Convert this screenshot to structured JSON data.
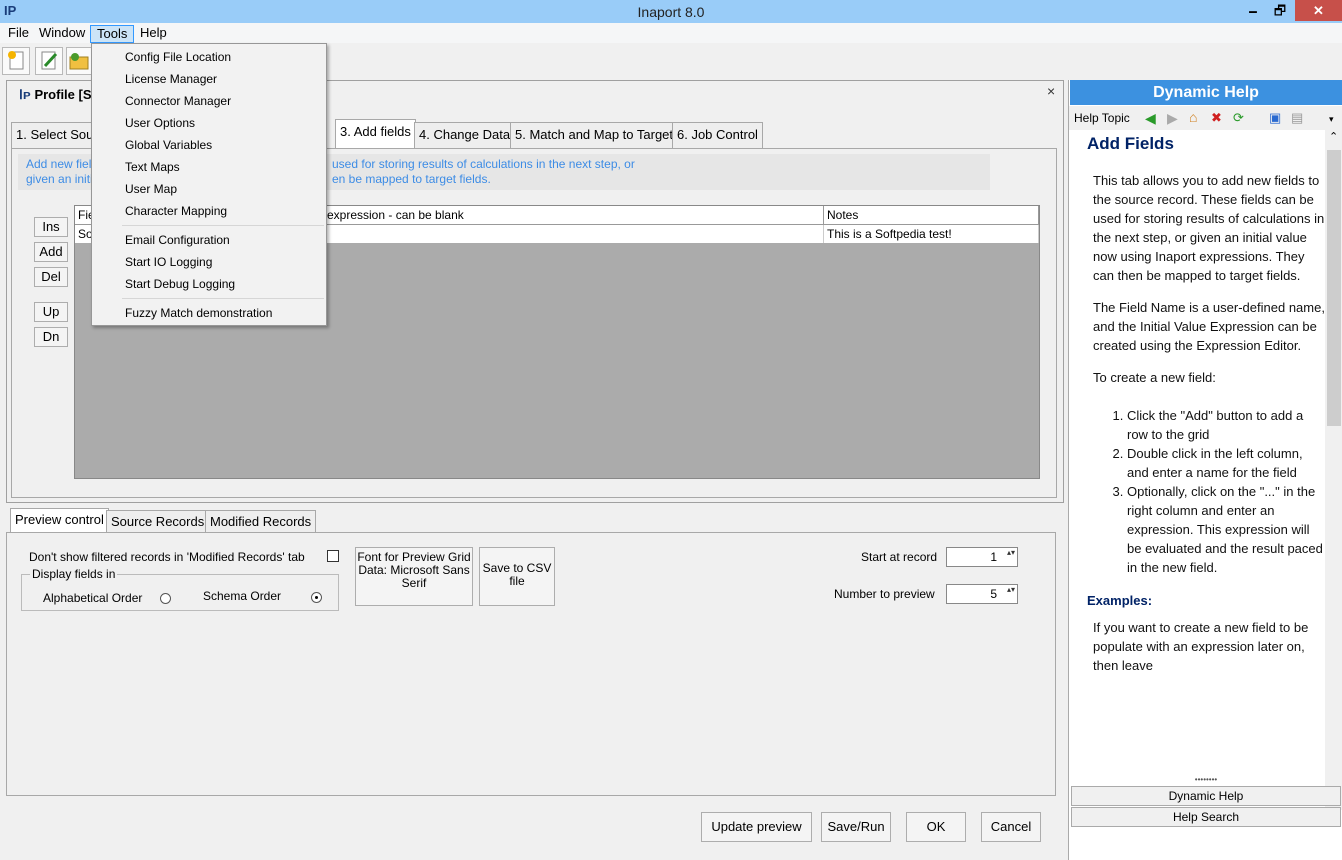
{
  "window": {
    "title": "Inaport 8.0",
    "min": "🗕",
    "max": "🗗",
    "close": "✕"
  },
  "menubar": {
    "items": [
      "File",
      "Window",
      "Tools",
      "Help"
    ]
  },
  "tools_menu": {
    "group1": [
      "Config File Location",
      "License Manager",
      "Connector Manager",
      "User Options",
      "Global Variables",
      "Text Maps",
      "User Map",
      "Character Mapping"
    ],
    "group2": [
      "Email Configuration",
      "Start IO Logging",
      "Start Debug Logging"
    ],
    "group3": [
      "Fuzzy Match demonstration"
    ]
  },
  "profile": {
    "title": "Profile [S",
    "close": "×",
    "tabs": [
      "1. Select Sour",
      "3. Add fields",
      "4. Change Data",
      "5. Match and Map to Target",
      "6. Job Control"
    ],
    "info_line1_left": "Add new fiel",
    "info_line1_right": "used for storing results of calculations in the next step, or",
    "info_line2_left": "given an initi",
    "info_line2_right": "en be mapped to target fields.",
    "side_buttons": [
      "Ins",
      "Add",
      "Del",
      "Up",
      "Dn"
    ],
    "grid": {
      "col1_header": "Fie",
      "col2_header": "expression - can be blank",
      "col3_header": "Notes",
      "row_col1": "So",
      "row_col3": "This is a Softpedia test!"
    }
  },
  "preview": {
    "tabs": [
      "Preview control",
      "Source Records",
      "Modified Records"
    ],
    "dont_show_label": "Don't show filtered records in 'Modified Records' tab",
    "display_group": "Display fields in",
    "alphabetical": "Alphabetical Order",
    "schema": "Schema Order",
    "font_button": "Font for Preview Grid Data: Microsoft Sans Serif",
    "save_csv": "Save to CSV file",
    "start_label": "Start at record",
    "start_value": "1",
    "number_label": "Number to preview",
    "number_value": "5"
  },
  "dialog_buttons": {
    "update": "Update preview",
    "saverun": "Save/Run",
    "ok": "OK",
    "cancel": "Cancel"
  },
  "help": {
    "header": "Dynamic Help",
    "toolbar_label": "Help Topic",
    "title": "Add Fields",
    "p1": "This tab allows you to add new fields to the source record. These fields can be used for storing results of calculations in the next step, or given an initial value now using Inaport expressions. They can then be mapped to target fields.",
    "p2": "The Field Name is a user-defined name, and the Initial Value Expression can be created using the Expression Editor.",
    "p3": "To create a new field:",
    "steps": [
      "Click the \"Add\" button to add a row to the grid",
      "Double click in the left column, and enter a name for the field",
      "Optionally, click on the \"...\" in the right column and enter an expression. This expression will be evaluated and the result paced in the new field."
    ],
    "examples": "Examples:",
    "p4": "If you want to create a new field to be populate with an expression later on, then leave",
    "tab1": "Dynamic Help",
    "tab2": "Help Search"
  }
}
